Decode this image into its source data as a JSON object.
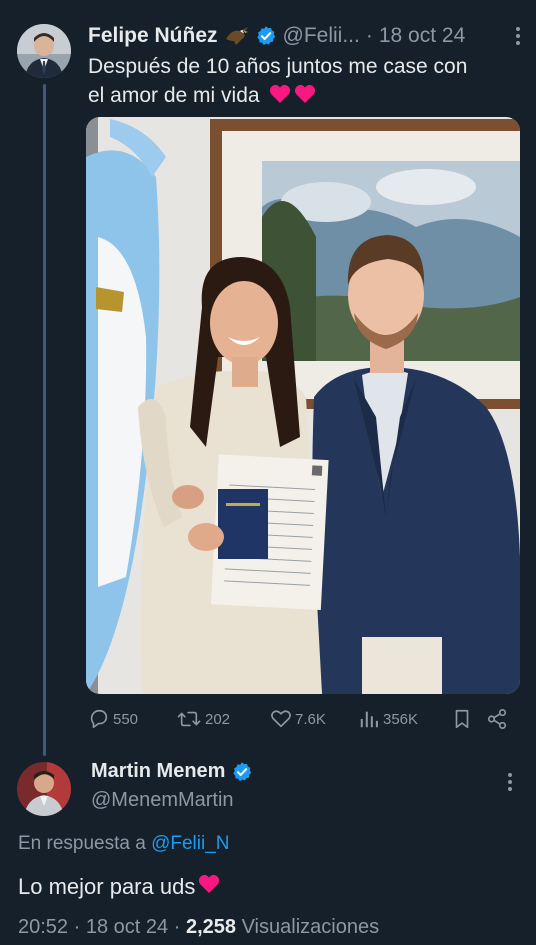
{
  "tweet": {
    "author_name": "Felipe Núñez",
    "author_handle": "@Felii...",
    "separator": "·",
    "date": "18 oct 24",
    "text_line1": "Después de 10 años juntos me case con",
    "text_line2": "el amor de mi vida",
    "text_emoji": "❤️❤️",
    "name_emoji_icon": "eagle-icon",
    "stats": {
      "replies": "550",
      "retweets": "202",
      "likes": "7.6K",
      "views": "356K"
    }
  },
  "reply": {
    "author_name": "Martin Menem",
    "author_handle": "@MenemMartin",
    "in_reply_prefix": "En respuesta a",
    "in_reply_mention": "@Felii_N",
    "text": "Lo mejor para uds",
    "text_emoji": "❤️",
    "time": "20:52",
    "date": "18 oct 24",
    "separator": "·",
    "views_count": "2,258",
    "views_label": "Visualizaciones"
  },
  "colors": {
    "background": "#15202b",
    "text": "#e7e9ea",
    "muted": "#8b98a5",
    "accent": "#1d9bf0",
    "thread_line": "#3e5a7a",
    "heart": "#f91880"
  }
}
